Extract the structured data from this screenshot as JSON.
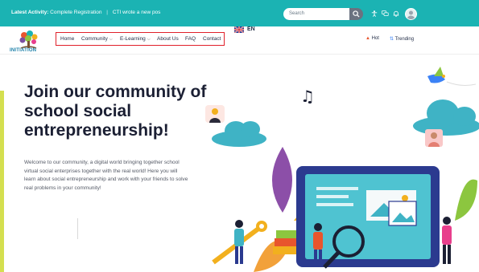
{
  "topbar": {
    "latest_label": "Latest Activity:",
    "activities": [
      "Complete Registration",
      "CTI wrote a new pos"
    ],
    "search_placeholder": "Search"
  },
  "logo": {
    "text": "INITIATION"
  },
  "nav": {
    "items": [
      "Home",
      "Community",
      "E-Learning",
      "About Us",
      "FAQ",
      "Contact"
    ],
    "language": "EN",
    "hot": "Hot",
    "trending": "Trending"
  },
  "hero": {
    "title": "Join our community of school social entrepreneurship!",
    "text": "Welcome to our community, a digital world bringing together school virtual social enterprises together with the real world! Here you will learn about social entrepreneurship and work with your friends to solve real problems in your community!"
  },
  "colors": {
    "teal": "#1bb3b3",
    "lime_bar": "#d4df4f",
    "nav_outline": "#e0202a",
    "title": "#1b1f33"
  },
  "icons": [
    "search-icon",
    "accessibility-icon",
    "messages-icon",
    "bell-icon",
    "avatar",
    "uk-flag-icon",
    "fire-icon",
    "trending-icon",
    "music-notes-icon",
    "bird-icon"
  ]
}
